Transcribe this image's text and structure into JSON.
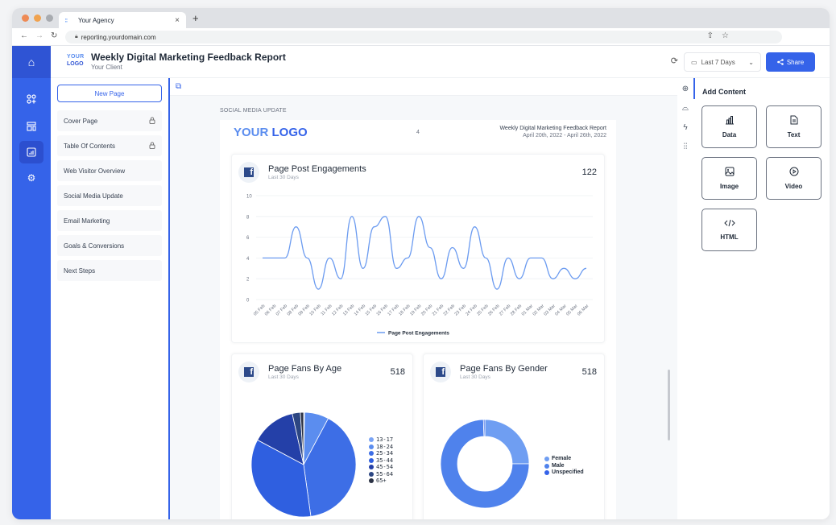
{
  "browser": {
    "tab_title": "Your Agency",
    "new_tab": "+",
    "close_tab": "×",
    "url": "reporting.yourdomain.com"
  },
  "header": {
    "logo_top": "YOUR",
    "logo_bottom": "LOGO",
    "title": "Weekly Digital Marketing Feedback Report",
    "subtitle": "Your Client",
    "date_range": "Last 7 Days",
    "share_label": "Share"
  },
  "rail": {
    "items": [
      {
        "icon": "home-icon",
        "glyph": "⌂"
      },
      {
        "icon": "apps-add-icon",
        "glyph": "⁘"
      },
      {
        "icon": "layout-icon",
        "glyph": "▤"
      },
      {
        "icon": "report-icon",
        "glyph": "▣",
        "active": true
      },
      {
        "icon": "settings-icon",
        "glyph": "⚙"
      }
    ]
  },
  "pages": {
    "new_page_label": "New Page",
    "items": [
      {
        "label": "Cover Page",
        "locked": true
      },
      {
        "label": "Table Of Contents",
        "locked": true
      },
      {
        "label": "Web Visitor Overview",
        "locked": false
      },
      {
        "label": "Social Media Update",
        "locked": false
      },
      {
        "label": "Email Marketing",
        "locked": false
      },
      {
        "label": "Goals & Conversions",
        "locked": false
      },
      {
        "label": "Next Steps",
        "locked": false
      }
    ]
  },
  "canvas": {
    "section_label": "SOCIAL MEDIA UPDATE",
    "sheet": {
      "logo_your": "YOUR",
      "logo_logo": "LOGO",
      "page_number": "4",
      "report_title": "Weekly Digital Marketing Feedback Report",
      "report_dates": "April 20th, 2022 - April 26th, 2022"
    }
  },
  "cards": {
    "engagements": {
      "title": "Page Post Engagements",
      "subtitle": "Last 30 Days",
      "value": "122"
    },
    "fans_age": {
      "title": "Page Fans By Age",
      "subtitle": "Last 30 Days",
      "value": "518"
    },
    "fans_gender": {
      "title": "Page Fans By Gender",
      "subtitle": "Last 30 Days",
      "value": "518"
    }
  },
  "add_content": {
    "title": "Add Content",
    "tiles": [
      {
        "label": "Data",
        "icon": "bar-chart-icon",
        "glyph": "📊"
      },
      {
        "label": "Text",
        "icon": "document-icon",
        "glyph": "🗎"
      },
      {
        "label": "Image",
        "icon": "image-icon",
        "glyph": "🖼"
      },
      {
        "label": "Video",
        "icon": "play-circle-icon",
        "glyph": "⏵"
      },
      {
        "label": "HTML",
        "icon": "code-icon",
        "glyph": "</>"
      }
    ]
  },
  "colors": {
    "primary": "#3563e9",
    "line": "#6b9bf0"
  },
  "chart_data": [
    {
      "type": "line",
      "title": "Page Post Engagements",
      "x": [
        "05 Feb",
        "06 Feb",
        "07 Feb",
        "08 Feb",
        "09 Feb",
        "10 Feb",
        "11 Feb",
        "12 Feb",
        "13 Feb",
        "14 Feb",
        "15 Feb",
        "16 Feb",
        "17 Feb",
        "18 Feb",
        "19 Feb",
        "20 Feb",
        "21 Feb",
        "22 Feb",
        "23 Feb",
        "24 Feb",
        "25 Feb",
        "26 Feb",
        "27 Feb",
        "28 Feb",
        "01 Mar",
        "02 Mar",
        "03 Mar",
        "04 Mar",
        "05 Mar",
        "06 Mar"
      ],
      "series": [
        {
          "name": "Page Post Engagements",
          "values": [
            4,
            4,
            4,
            7,
            4,
            1,
            4,
            2,
            8,
            3,
            7,
            8,
            3,
            4,
            8,
            5,
            2,
            5,
            3,
            7,
            4,
            1,
            4,
            2,
            4,
            4,
            2,
            3,
            2,
            3
          ]
        }
      ],
      "yticks": [
        0,
        2,
        4,
        6,
        8,
        10
      ],
      "ylim": [
        0,
        10
      ],
      "grid": true,
      "legend": "bottom"
    },
    {
      "type": "pie",
      "title": "Page Fans By Age",
      "categories": [
        "13-17",
        "18-24",
        "25-34",
        "35-44",
        "45-54",
        "55-64",
        "65+"
      ],
      "values": [
        0.3,
        7.5,
        40,
        35,
        13.7,
        2.5,
        1
      ],
      "colors": [
        "#7aa4f5",
        "#5b8def",
        "#3d6ee6",
        "#2f5fe0",
        "#2440a8",
        "#2c4682",
        "#2b3245"
      ],
      "legend": "right"
    },
    {
      "type": "pie",
      "title": "Page Fans By Gender",
      "categories": [
        "Female",
        "Male",
        "Unspecified"
      ],
      "values": [
        25,
        74.5,
        0.5
      ],
      "colors": [
        "#6f9ef2",
        "#4f82ec",
        "#3563e9"
      ],
      "donut": true,
      "legend": "right"
    }
  ]
}
